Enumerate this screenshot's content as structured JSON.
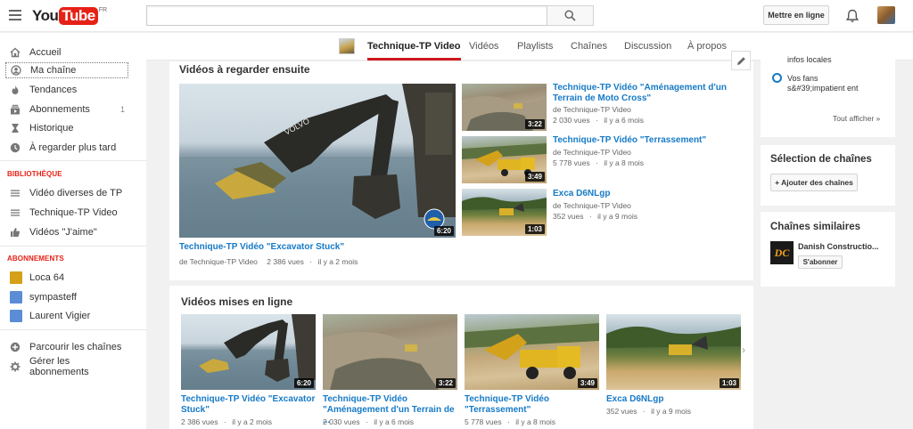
{
  "masthead": {
    "logo_you": "You",
    "logo_tube": "Tube",
    "logo_region": "FR",
    "search_placeholder": "",
    "upload_label": "Mettre en ligne"
  },
  "sidebar": {
    "main_items": [
      {
        "label": "Accueil",
        "icon": "home-icon"
      },
      {
        "label": "Ma chaîne",
        "icon": "user-icon"
      },
      {
        "label": "Tendances",
        "icon": "flame-icon"
      },
      {
        "label": "Abonnements",
        "icon": "subscriptions-icon",
        "count": "1"
      },
      {
        "label": "Historique",
        "icon": "hourglass-icon"
      },
      {
        "label": "À regarder plus tard",
        "icon": "clock-icon"
      }
    ],
    "library_heading": "BIBLIOTHÈQUE",
    "library_items": [
      {
        "label": "Vidéo diverses de TP",
        "icon": "playlist-icon"
      },
      {
        "label": "Technique-TP Video",
        "icon": "playlist-icon"
      },
      {
        "label": "Vidéos \"J'aime\"",
        "icon": "thumbs-up-icon"
      }
    ],
    "subscriptions_heading": "ABONNEMENTS",
    "subscriptions": [
      {
        "label": "Loca 64",
        "thumb_color": "#d4a017"
      },
      {
        "label": "sympasteff",
        "thumb_color": "#5b8dd6"
      },
      {
        "label": "Laurent Vigier",
        "thumb_color": "#5b8dd6"
      }
    ],
    "footer_items": [
      {
        "label": "Parcourir les chaînes",
        "icon": "plus-circle-icon"
      },
      {
        "label": "Gérer les abonnements",
        "icon": "gear-icon"
      }
    ]
  },
  "channel_tabs": [
    {
      "label": "Technique-TP Video",
      "active": true
    },
    {
      "label": "Vidéos",
      "active": false
    },
    {
      "label": "Playlists",
      "active": false
    },
    {
      "label": "Chaînes",
      "active": false
    },
    {
      "label": "Discussion",
      "active": false
    },
    {
      "label": "À propos",
      "active": false
    }
  ],
  "watch_next": {
    "title": "Vidéos à regarder ensuite",
    "featured": {
      "title": "Technique-TP Vidéo \"Excavator Stuck\"",
      "byline": "de Technique-TP Video",
      "views": "2 386 vues",
      "age": "il y a 2 mois",
      "duration": "6:20"
    },
    "list": [
      {
        "title": "Technique-TP Vidéo \"Aménagement d'un Terrain de Moto Cross\"",
        "byline": "de Technique-TP Video",
        "views": "2 030 vues",
        "age": "il y a 6 mois",
        "duration": "3:22"
      },
      {
        "title": "Technique-TP Vidéo \"Terrassement\"",
        "byline": "de Technique-TP Video",
        "views": "5 778 vues",
        "age": "il y a 8 mois",
        "duration": "3:49"
      },
      {
        "title": "Exca D6NLgp",
        "byline": "de Technique-TP Video",
        "views": "352 vues",
        "age": "il y a 9 mois",
        "duration": "1:03"
      }
    ]
  },
  "uploads": {
    "title": "Vidéos mises en ligne",
    "videos": [
      {
        "title": "Technique-TP Vidéo \"Excavator Stuck\"",
        "views": "2 386 vues",
        "age": "il y a 2 mois",
        "duration": "6:20"
      },
      {
        "title": "Technique-TP Vidéo \"Aménagement d'un Terrain de ...",
        "views": "2 030 vues",
        "age": "il y a 6 mois",
        "duration": "3:22"
      },
      {
        "title": "Technique-TP Vidéo \"Terrassement\"",
        "views": "5 778 vues",
        "age": "il y a 8 mois",
        "duration": "3:49"
      },
      {
        "title": "Exca D6NLgp",
        "views": "352 vues",
        "age": "il y a 9 mois",
        "duration": "1:03"
      }
    ]
  },
  "right_column": {
    "privacy": {
      "option1": "infos locales",
      "option2": "Vos fans s&#39;impatient ent",
      "show_all": "Tout afficher"
    },
    "featured_channels": {
      "title": "Sélection de chaînes",
      "add_button": "+ Ajouter des chaînes"
    },
    "related_channels": {
      "title": "Chaînes similaires",
      "channel_name": "Danish Constructio...",
      "logo_text": "DC",
      "subscribe": "S'abonner"
    }
  },
  "colors": {
    "accent_red": "#e62117",
    "link_blue": "#167ac6",
    "tab_underline": "#cc181e"
  }
}
